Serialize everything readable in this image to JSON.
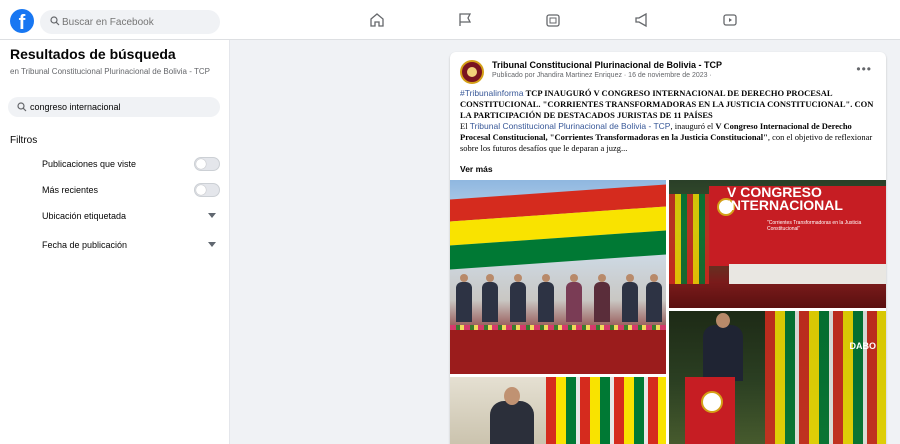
{
  "header": {
    "search_placeholder": "Buscar en Facebook"
  },
  "colors": {
    "brand": "#1877f2",
    "link": "#385898"
  },
  "icons": [
    "facebook-logo-icon",
    "search-icon",
    "home-icon",
    "flag-icon",
    "marketplace-icon",
    "megaphone-icon",
    "watch-icon"
  ],
  "sidebar": {
    "title": "Resultados de búsqueda",
    "subtitle": "en Tribunal Constitucional Plurinacional de Bolivia - TCP",
    "query": "congreso internacional",
    "filters_label": "Filtros",
    "filters": [
      {
        "label": "Publicaciones que viste",
        "control": "toggle"
      },
      {
        "label": "Más recientes",
        "control": "toggle"
      },
      {
        "label": "Ubicación etiquetada",
        "control": "dropdown"
      },
      {
        "label": "Fecha de publicación",
        "control": "dropdown"
      }
    ]
  },
  "post": {
    "page_name": "Tribunal Constitucional Plurinacional de Bolivia - TCP",
    "meta": "Publicado por Jhandira Martinez Enriquez · 16 de noviembre de 2023 ·",
    "hashtag": "#Tribunalinforma",
    "headline": "TCP INAUGURÓ V CONGRESO INTERNACIONAL DE DERECHO PROCESAL CONSTITUCIONAL. \"CORRIENTES TRANSFORMADORAS EN LA JUSTICIA CONSTITUCIONAL\". CON LA PARTICIPACIÓN DE DESTACADOS JURISTAS DE 11 PAÍSES",
    "body_prefix": "El",
    "body_link": "Tribunal Constitucional Plurinacional de Bolivia - TCP",
    "body_mid": ", inauguró el",
    "body_bold": "V Congreso Internacional de Derecho Procesal Constitucional, \"Corrientes Transformadoras en la Justicia Constitucional\"",
    "body_suffix": ", con el objetivo de reflexionar sobre los futuros desafíos que le deparan a juzg...",
    "see_more": "Ver más",
    "photo2_banner_title": "V CONGRESO INTERNACIONAL",
    "photo2_banner_sub": "\"Corrientes Transformadoras en la Justicia Constitucional\"",
    "photo3_tag": "DABO"
  }
}
